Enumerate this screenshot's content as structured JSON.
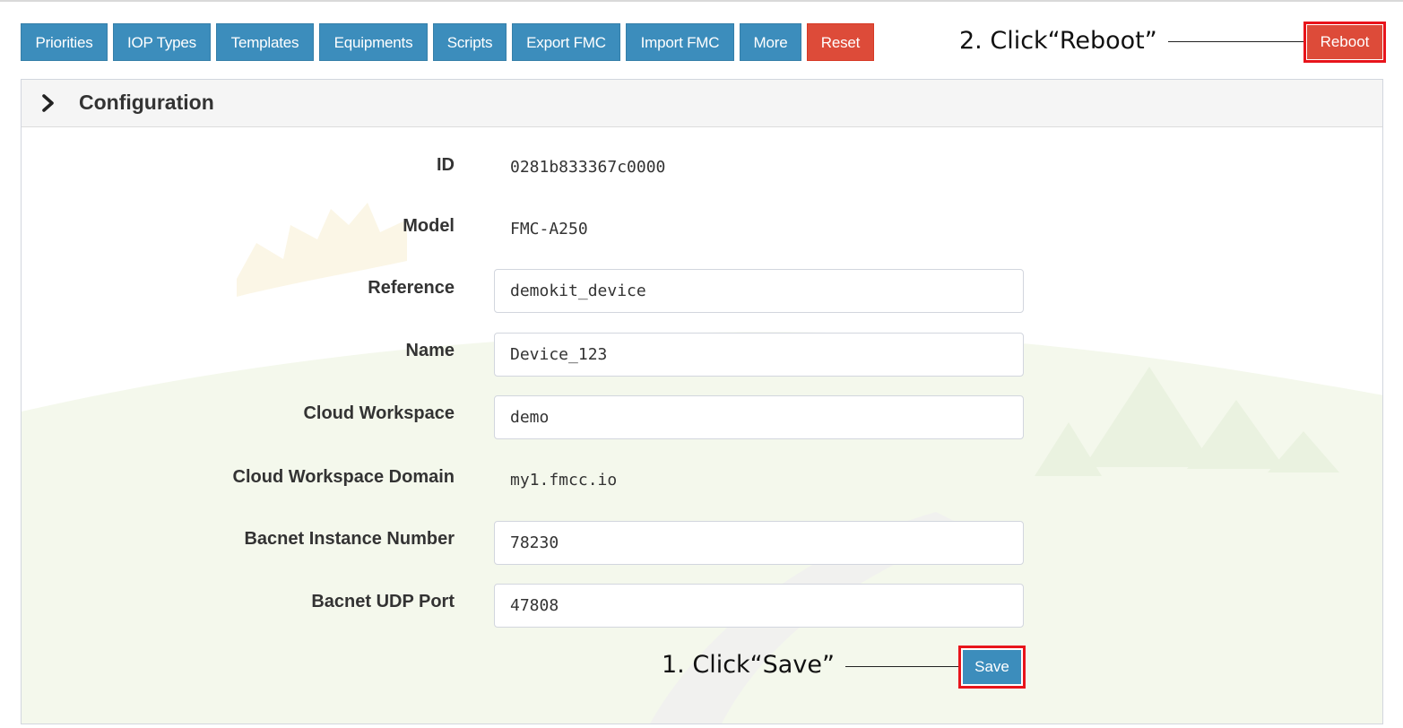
{
  "toolbar": {
    "buttons": [
      {
        "label": "Priorities"
      },
      {
        "label": "IOP Types"
      },
      {
        "label": "Templates"
      },
      {
        "label": "Equipments"
      },
      {
        "label": "Scripts"
      },
      {
        "label": "Export FMC"
      },
      {
        "label": "Import FMC"
      },
      {
        "label": "More"
      },
      {
        "label": "Reset"
      }
    ],
    "reboot_label": "Reboot"
  },
  "annotations": {
    "step2": "2. Click“Reboot”",
    "step1": "1. Click“Save”"
  },
  "panel": {
    "title": "Configuration",
    "toggle_icon": "chevron-right-icon"
  },
  "config": {
    "id": {
      "label": "ID",
      "value": "0281b833367c0000"
    },
    "model": {
      "label": "Model",
      "value": "FMC-A250"
    },
    "reference": {
      "label": "Reference",
      "value": "demokit_device"
    },
    "name": {
      "label": "Name",
      "value": "Device_123"
    },
    "cloud_workspace": {
      "label": "Cloud Workspace",
      "value": "demo"
    },
    "cloud_workspace_domain": {
      "label": "Cloud Workspace Domain",
      "value": "my1.fmcc.io"
    },
    "bacnet_instance_number": {
      "label": "Bacnet Instance Number",
      "value": "78230"
    },
    "bacnet_udp_port": {
      "label": "Bacnet UDP Port",
      "value": "47808"
    }
  },
  "save_label": "Save",
  "colors": {
    "primary": "#3c8dbc",
    "danger": "#dd4b39",
    "highlight_box": "#e8141b"
  }
}
